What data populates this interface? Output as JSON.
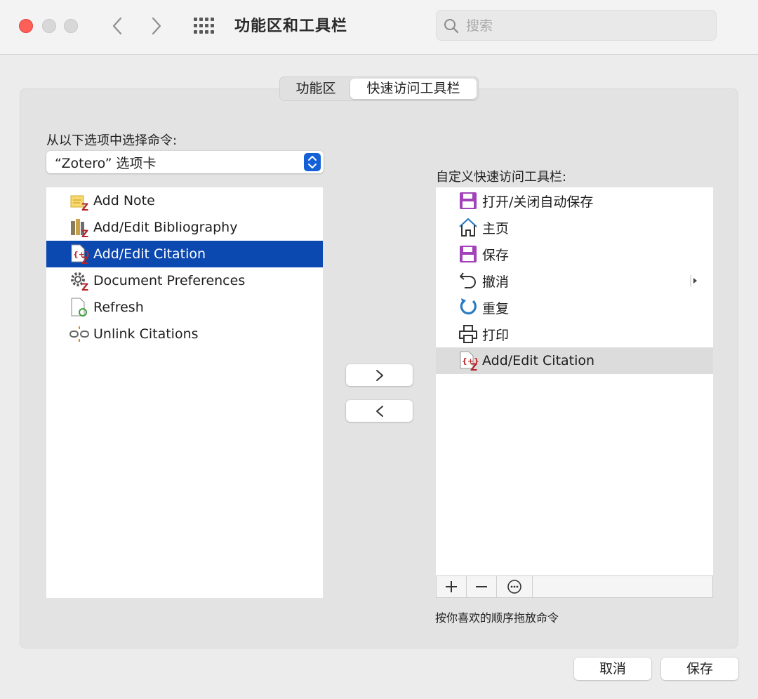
{
  "window": {
    "title": "功能区和工具栏"
  },
  "search": {
    "placeholder": "搜索",
    "value": ""
  },
  "tabs": [
    {
      "label": "功能区",
      "selected": false
    },
    {
      "label": "快速访问工具栏",
      "selected": true
    }
  ],
  "left": {
    "label": "从以下选项中选择命令:",
    "dropdown_value": "“Zotero” 选项卡",
    "items": [
      {
        "label": "Add Note",
        "icon": "zotero-add-note-icon"
      },
      {
        "label": "Add/Edit Bibliography",
        "icon": "zotero-bibliography-icon"
      },
      {
        "label": "Add/Edit Citation",
        "icon": "zotero-citation-icon",
        "selected": true
      },
      {
        "label": "Document Preferences",
        "icon": "zotero-preferences-gear-icon"
      },
      {
        "label": "Refresh",
        "icon": "refresh-document-icon"
      },
      {
        "label": "Unlink Citations",
        "icon": "unlink-chain-icon"
      }
    ]
  },
  "right": {
    "label": "自定义快速访问工具栏:",
    "items": [
      {
        "label": "打开/关闭自动保存",
        "icon": "autosave-floppy-icon"
      },
      {
        "label": "主页",
        "icon": "home-icon"
      },
      {
        "label": "保存",
        "icon": "save-floppy-icon"
      },
      {
        "label": "撤消",
        "icon": "undo-icon",
        "has_submenu": true
      },
      {
        "label": "重复",
        "icon": "redo-icon"
      },
      {
        "label": "打印",
        "icon": "print-icon"
      },
      {
        "label": "Add/Edit Citation",
        "icon": "zotero-citation-icon",
        "selected": true
      }
    ],
    "hint": "按你喜欢的顺序拖放命令"
  },
  "buttons": {
    "cancel": "取消",
    "save": "保存"
  },
  "colors": {
    "selection": "#0b48b0",
    "accent": "#1460d6",
    "close": "#fe5f57"
  }
}
